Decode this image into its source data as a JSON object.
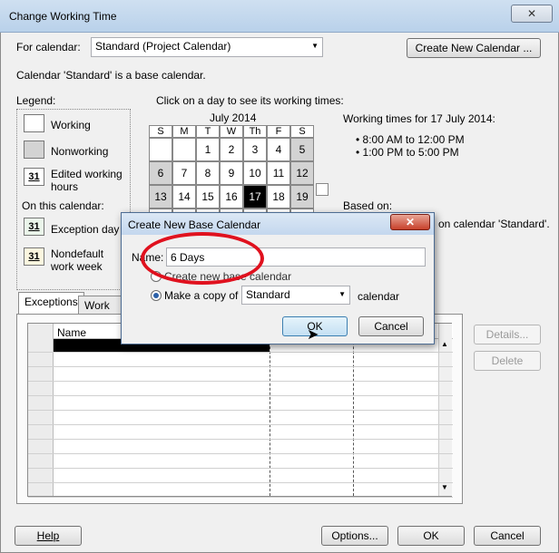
{
  "window": {
    "title": "Change Working Time",
    "close_glyph": "✕"
  },
  "top": {
    "for_calendar_label": "For calendar:",
    "calendar_value": "Standard (Project Calendar)",
    "create_new_calendar_button": "Create New Calendar ...",
    "base_calendar_note": "Calendar 'Standard' is a base calendar."
  },
  "legend": {
    "heading": "Legend:",
    "working": "Working",
    "nonworking": "Nonworking",
    "edited_working_hours": "Edited working hours",
    "edited_num": "31",
    "on_this_calendar": "On this calendar:",
    "exception_day": "Exception day",
    "exception_num": "31",
    "nondefault_work_week": "Nondefault work week",
    "nondefault_num": "31"
  },
  "calendar": {
    "instruction": "Click on a day to see its working times:",
    "month": "July 2014",
    "day_headers": [
      "S",
      "M",
      "T",
      "W",
      "Th",
      "F",
      "S"
    ],
    "week1": [
      "",
      "",
      "1",
      "2",
      "3",
      "4",
      "5"
    ],
    "week2": [
      "6",
      "7",
      "8",
      "9",
      "10",
      "11",
      "12"
    ],
    "week3": [
      "13",
      "14",
      "15",
      "16",
      "17",
      "18",
      "19"
    ],
    "selected_day": "17"
  },
  "working_times": {
    "heading": "Working times for 17 July 2014:",
    "slot1": "8:00 AM to 12:00 PM",
    "slot2": "1:00 PM to 5:00 PM",
    "based_on": "Based on:",
    "based_on_tail": "on calendar 'Standard'."
  },
  "tabs": {
    "exceptions": "Exceptions",
    "work_weeks": "Work We"
  },
  "grid": {
    "name_header": "Name"
  },
  "side_buttons": {
    "details": "Details...",
    "delete": "Delete"
  },
  "bottom": {
    "help": "Help",
    "options": "Options...",
    "ok": "OK",
    "cancel": "Cancel"
  },
  "dialog": {
    "title": "Create New Base Calendar",
    "close_glyph": "✕",
    "name_label": "Name:",
    "name_value": "6 Days",
    "option_create_new": "Create new base calendar",
    "option_make_copy": "Make a copy of",
    "copy_source": "Standard",
    "copy_suffix": "calendar",
    "ok": "OK",
    "cancel": "Cancel"
  },
  "colors": {
    "highlight_ring": "#e0111e",
    "selected_day": "#000000"
  }
}
